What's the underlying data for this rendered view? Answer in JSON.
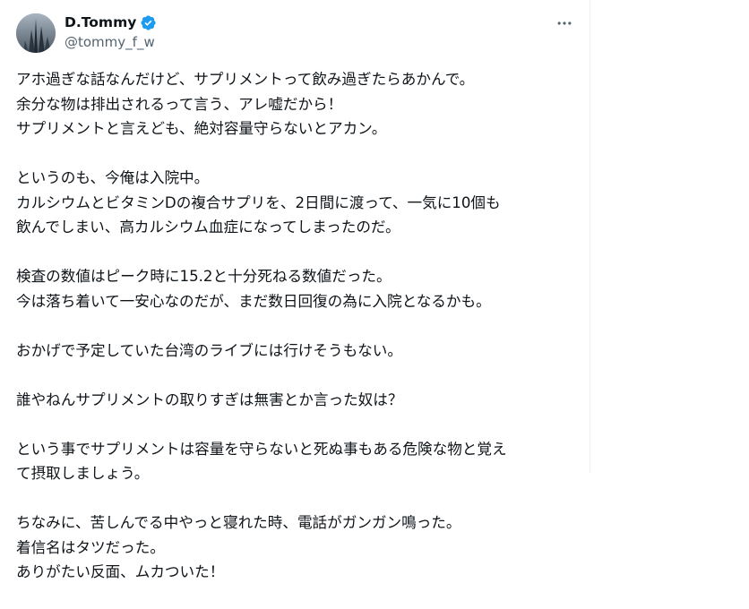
{
  "author": {
    "display_name": "D.Tommy",
    "handle": "@tommy_f_w",
    "verified": true
  },
  "menu": {
    "icon": "more-horizontal-icon"
  },
  "tweet": {
    "paragraphs": [
      {
        "lines": [
          "アホ過ぎな話なんだけど、サプリメントって飲み過ぎたらあかんで。",
          "余分な物は排出されるって言う、アレ嘘だから！",
          "サプリメントと言えども、絶対容量守らないとアカン。"
        ]
      },
      {
        "lines": [
          "というのも、今俺は入院中。",
          "カルシウムとビタミンDの複合サプリを、2日間に渡って、一気に10個も",
          "飲んでしまい、高カルシウム血症になってしまったのだ。"
        ]
      },
      {
        "lines": [
          "検査の数値はピーク時に15.2と十分死ねる数値だった。",
          "今は落ち着いて一安心なのだが、まだ数日回復の為に入院となるかも。"
        ]
      },
      {
        "lines": [
          "おかげで予定していた台湾のライブには行けそうもない。"
        ]
      },
      {
        "lines": [
          "誰やねんサプリメントの取りすぎは無害とか言った奴は？"
        ]
      },
      {
        "lines": [
          "という事でサプリメントは容量を守らないと死ぬ事もある危険な物と覚え",
          "て摂取しましょう。"
        ]
      },
      {
        "lines": [
          "ちなみに、苦しんでる中やっと寝れた時、電話がガンガン鳴った。",
          "着信名はタツだった。",
          "ありがたい反面、ムカついた！"
        ]
      }
    ]
  },
  "colors": {
    "text": "#0f1419",
    "secondary": "#536471",
    "verified_blue": "#1d9bf0",
    "divider": "#eff3f4"
  }
}
